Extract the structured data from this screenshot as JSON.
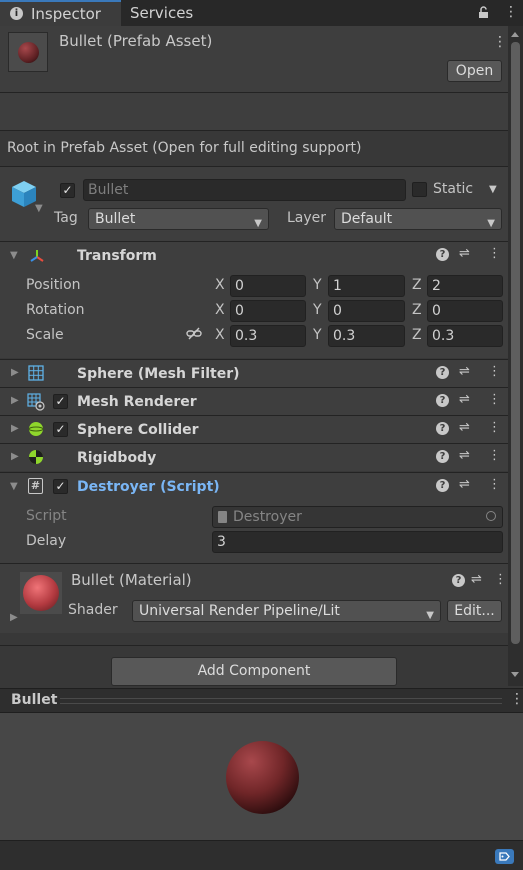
{
  "tabs": [
    {
      "label": "Inspector"
    },
    {
      "label": "Services"
    }
  ],
  "header": {
    "title": "Bullet (Prefab Asset)",
    "open_label": "Open"
  },
  "root_notice": "Root in Prefab Asset (Open for full editing support)",
  "gameobject": {
    "name": "Bullet",
    "static_label": "Static",
    "tag_label": "Tag",
    "tag_value": "Bullet",
    "layer_label": "Layer",
    "layer_value": "Default"
  },
  "transform": {
    "title": "Transform",
    "rows": [
      {
        "label": "Position",
        "x": "0",
        "y": "1",
        "z": "2"
      },
      {
        "label": "Rotation",
        "x": "0",
        "y": "0",
        "z": "0"
      },
      {
        "label": "Scale",
        "x": "0.3",
        "y": "0.3",
        "z": "0.3"
      }
    ],
    "axis_x": "X",
    "axis_y": "Y",
    "axis_z": "Z"
  },
  "components": [
    {
      "title": "Sphere (Mesh Filter)",
      "icon": "grid-icon"
    },
    {
      "title": "Mesh Renderer",
      "icon": "mesh-renderer-icon"
    },
    {
      "title": "Sphere Collider",
      "icon": "sphere-collider-icon"
    },
    {
      "title": "Rigidbody",
      "icon": "rigidbody-icon"
    }
  ],
  "destroyer": {
    "title": "Destroyer (Script)",
    "script_label": "Script",
    "script_value": "Destroyer",
    "delay_label": "Delay",
    "delay_value": "3"
  },
  "material": {
    "title": "Bullet (Material)",
    "shader_label": "Shader",
    "shader_value": "Universal Render Pipeline/Lit",
    "edit_label": "Edit..."
  },
  "add_component": "Add Component",
  "preview": {
    "title": "Bullet"
  },
  "colors": {
    "accent": "#3a79bb",
    "script_title": "#7ab6f5",
    "sphere": "#7a2a2e"
  }
}
